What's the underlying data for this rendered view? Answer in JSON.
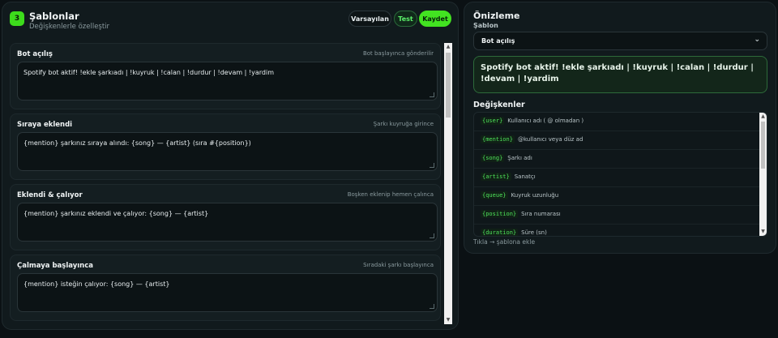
{
  "left": {
    "step": "3",
    "title": "Şablonlar",
    "subtitle": "Değişkenlerle özelleştir",
    "buttons": {
      "defaults": "Varsayılan",
      "test": "Test",
      "save": "Kaydet"
    },
    "cards": [
      {
        "title": "Bot açılış",
        "hint": "Bot başlayınca gönderilir",
        "text": "Spotify bot aktif! !ekle şarkıadı | !kuyruk | !calan | !durdur | !devam | !yardim"
      },
      {
        "title": "Sıraya eklendi",
        "hint": "Şarkı kuyruğa girince",
        "text": "{mention} şarkınız sıraya alındı: {song} — {artist} (sıra #{position})"
      },
      {
        "title": "Eklendi & çalıyor",
        "hint": "Boşken eklenip hemen çalınca",
        "text": "{mention} şarkınız eklendi ve çalıyor: {song} — {artist}"
      },
      {
        "title": "Çalmaya başlayınca",
        "hint": "Sıradaki şarkı başlayınca",
        "text": "{mention} isteğin çalıyor: {song} — {artist}"
      }
    ]
  },
  "right": {
    "title": "Önizleme",
    "template_label": "Şablon",
    "selected_template": "Bot açılış",
    "preview_text": "Spotify bot aktif! !ekle şarkıadı | !kuyruk | !calan | !durdur | !devam | !yardim",
    "vars_title": "Değişkenler",
    "variables": [
      {
        "code": "{user}",
        "desc": "Kullanıcı adı ( @ olmadan )"
      },
      {
        "code": "{mention}",
        "desc": "@kullanıcı veya düz ad"
      },
      {
        "code": "{song}",
        "desc": "Şarkı adı"
      },
      {
        "code": "{artist}",
        "desc": "Sanatçı"
      },
      {
        "code": "{queue}",
        "desc": "Kuyruk uzunluğu"
      },
      {
        "code": "{position}",
        "desc": "Sıra numarası"
      },
      {
        "code": "{duration}",
        "desc": "Süre (sn)"
      }
    ],
    "footer": "Tıkla → şablona ekle"
  }
}
